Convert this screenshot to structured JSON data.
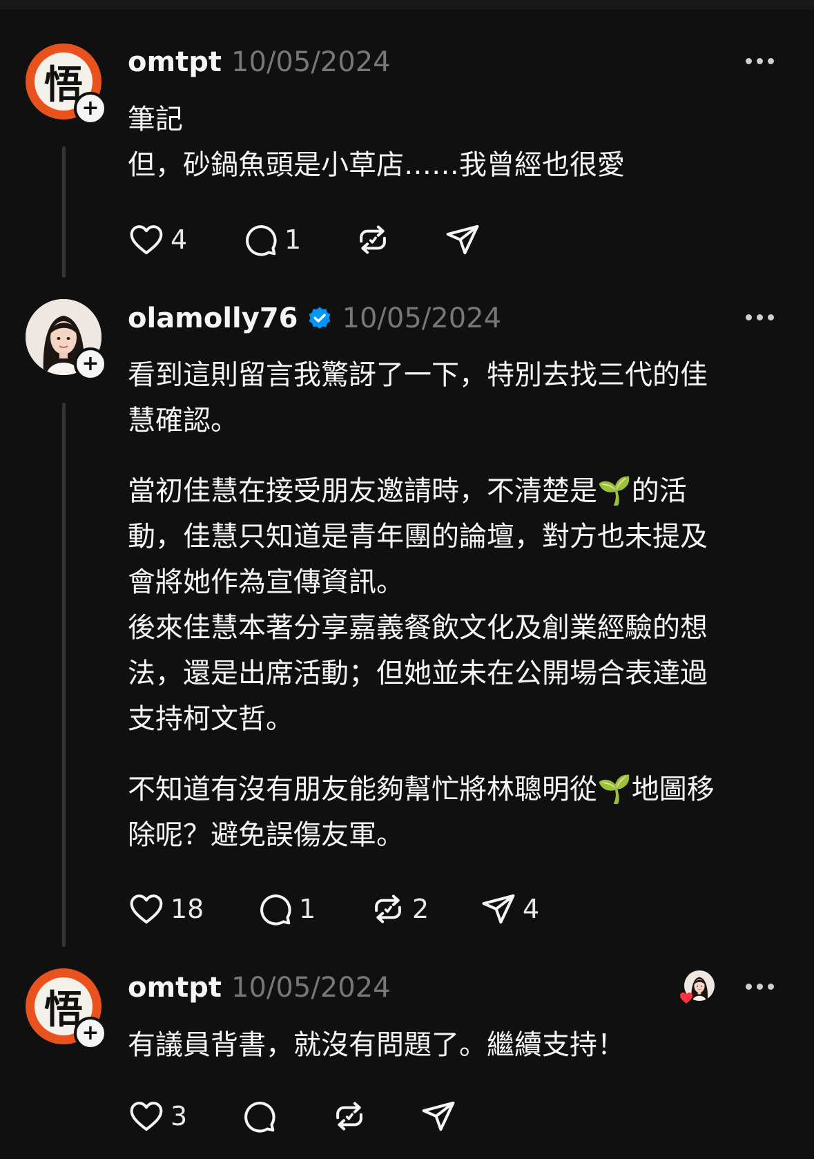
{
  "posts": [
    {
      "username": "omtpt",
      "date": "10/05/2024",
      "avatar_glyph": "悟",
      "lines": [
        "筆記",
        "但，砂鍋魚頭是小草店……我曾經也很愛"
      ],
      "likes": "4",
      "replies": "1",
      "reposts": "",
      "shares": ""
    },
    {
      "username": "olamolly76",
      "date": "10/05/2024",
      "verified": true,
      "paragraphs": [
        [
          "看到這則留言我驚訝了一下，特別去找三代的佳",
          "慧確認。"
        ],
        [
          "當初佳慧在接受朋友邀請時，不清楚是🌱的活",
          "動，佳慧只知道是青年團的論壇，對方也未提及",
          "會將她作為宣傳資訊。",
          "後來佳慧本著分享嘉義餐飲文化及創業經驗的想",
          "法，還是出席活動；但她並未在公開場合表達過",
          "支持柯文哲。"
        ],
        [
          "不知道有沒有朋友能夠幫忙將林聰明從🌱地圖移",
          "除呢？避免誤傷友軍。"
        ]
      ],
      "likes": "18",
      "replies": "1",
      "reposts": "2",
      "shares": "4"
    },
    {
      "username": "omtpt",
      "date": "10/05/2024",
      "avatar_glyph": "悟",
      "lines": [
        "有議員背書，就沒有問題了。繼續支持！"
      ],
      "likes": "3",
      "replies": "",
      "reposts": "",
      "shares": "",
      "liked_by_author": true
    }
  ],
  "icons": {
    "like": "heart-icon",
    "reply": "comment-icon",
    "repost": "repost-icon",
    "share": "send-icon",
    "more": "more-options-icon",
    "verified": "verified-badge-icon",
    "follow": "plus-icon"
  },
  "colors": {
    "background": "#101010",
    "text": "#f3f5f7",
    "muted": "#777777",
    "verified": "#0095f6",
    "goku_orange": "#e9521d",
    "heart": "#ff3040"
  }
}
